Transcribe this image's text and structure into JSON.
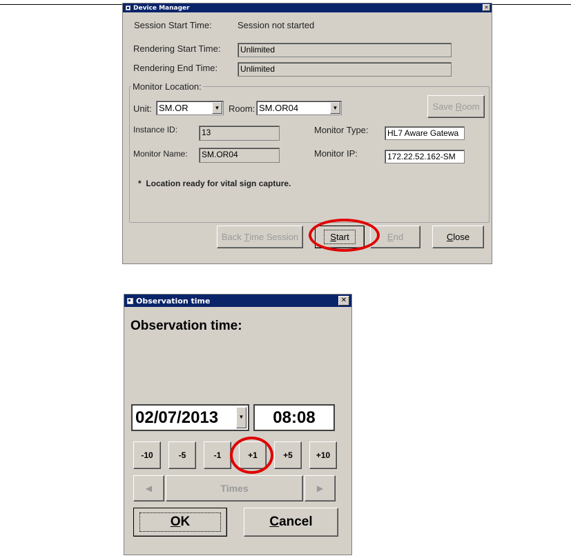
{
  "device_manager": {
    "title": "Device Manager",
    "close_glyph": "✕",
    "session_start_label": "Session Start Time:",
    "session_start_value": "Session not started",
    "rendering_start_label": "Rendering Start Time:",
    "rendering_start_value": "Unlimited",
    "rendering_end_label": "Rendering End Time:",
    "rendering_end_value": "Unlimited",
    "monitor_location": {
      "group_label": "Monitor Location:",
      "unit_label": "Unit:",
      "unit_value": "SM.OR",
      "room_label": "Room:",
      "room_value": "SM.OR04",
      "save_room_prefix": "Save ",
      "save_room_hotkey": "R",
      "save_room_rest": "oom",
      "instance_id_label": "Instance ID:",
      "instance_id_value": "13",
      "monitor_type_label": "Monitor Type:",
      "monitor_type_value": "HL7 Aware Gatewa",
      "monitor_name_label": "Monitor Name:",
      "monitor_name_value": "SM.OR04",
      "monitor_ip_label": "Monitor IP:",
      "monitor_ip_value": "172.22.52.162-SM",
      "status_message": "*  Location ready for vital sign capture."
    },
    "buttons": {
      "back_time_prefix": "Back ",
      "back_time_hotkey": "T",
      "back_time_rest": "ime Session",
      "start_hotkey": "S",
      "start_rest": "tart",
      "end_hotkey": "E",
      "end_rest": "nd",
      "close_hotkey": "C",
      "close_rest": "lose"
    }
  },
  "observation_time": {
    "title": "Observation time",
    "close_glyph": "✕",
    "heading": "Observation time:",
    "date_value": "02/07/2013",
    "time_value": "08:08",
    "adjust_buttons": [
      "-10",
      "-5",
      "-1",
      "+1",
      "+5",
      "+10"
    ],
    "times_label": "Times",
    "ok_hotkey": "O",
    "ok_rest": "K",
    "cancel_hotkey": "C",
    "cancel_rest": "ancel"
  },
  "colors": {
    "titlebar": "#0a246a",
    "window_face": "#d4d0c8",
    "annotation_ring": "#e00000"
  },
  "icons": [
    "window-app-icon",
    "close-icon",
    "dropdown-arrow-icon",
    "left-arrow-icon",
    "right-arrow-icon"
  ]
}
